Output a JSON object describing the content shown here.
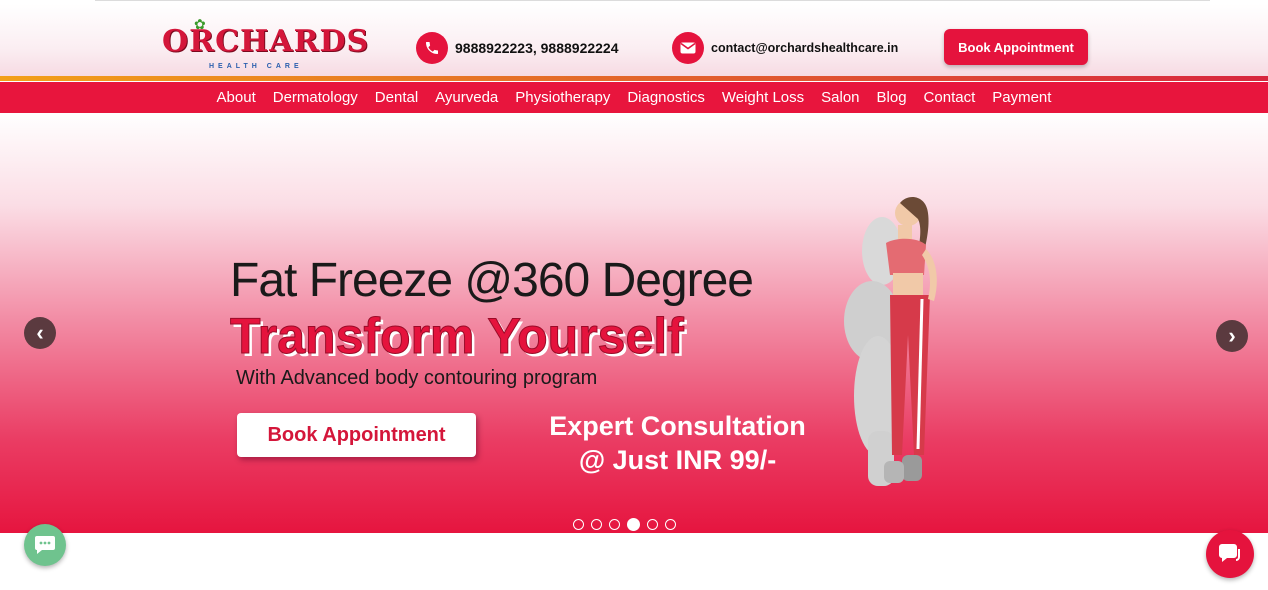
{
  "brand": {
    "logo_text": "ORCHARDS",
    "logo_subtext": "HEALTH CARE",
    "accent_color": "#e5133d"
  },
  "header": {
    "phone": "9888922223, 9888922224",
    "email": "contact@orchardshealthcare.in",
    "book_button": "Book Appointment"
  },
  "nav": {
    "items": [
      "About",
      "Dermatology",
      "Dental",
      "Ayurveda",
      "Physiotherapy",
      "Diagnostics",
      "Weight Loss",
      "Salon",
      "Blog",
      "Contact",
      "Payment"
    ]
  },
  "hero": {
    "line1": "Fat Freeze @360 Degree",
    "line2": "Transform Yourself",
    "line3": "With Advanced body contouring program",
    "button": "Book Appointment",
    "offer_line1": "Expert Consultation",
    "offer_line2": "@ Just INR 99/-",
    "prev_icon": "chevron-left-icon",
    "next_icon": "chevron-right-icon"
  },
  "carousel": {
    "slide_count": 6,
    "active_index": 3
  },
  "widgets": {
    "left_icon": "chat-bubble-icon",
    "right_icon": "messenger-icon"
  }
}
